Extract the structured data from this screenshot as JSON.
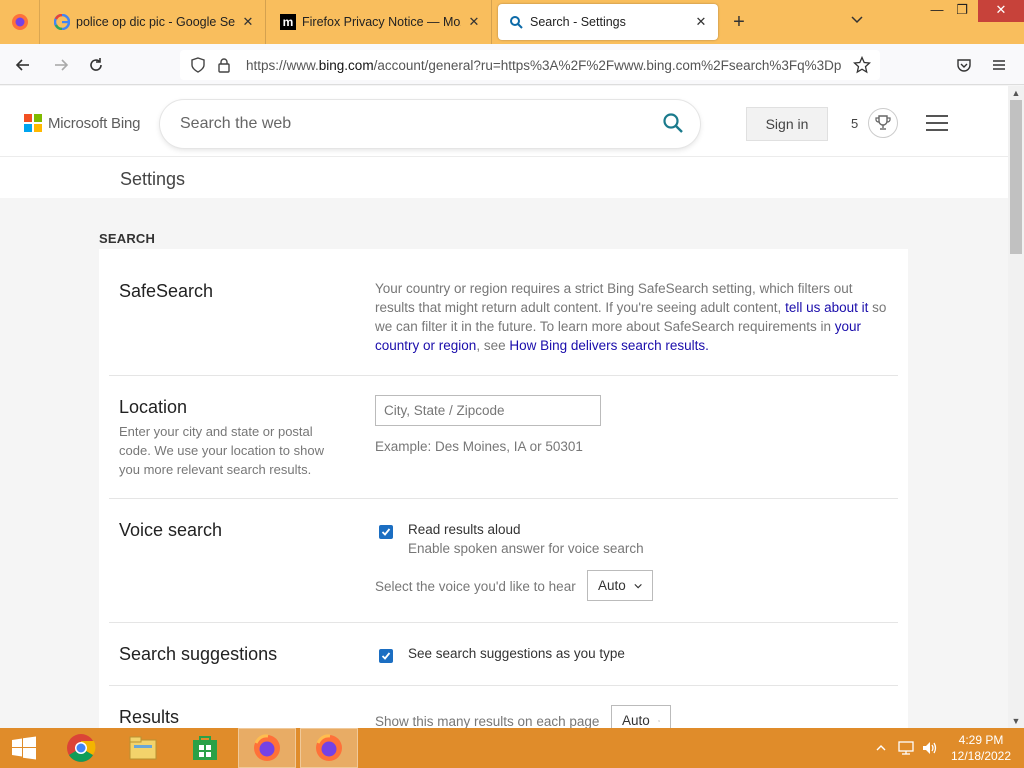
{
  "browser": {
    "tabs": [
      {
        "title": "police op dic pic - Google Searc",
        "close": "✕"
      },
      {
        "title": "Firefox Privacy Notice — Mozilla",
        "close": "✕"
      },
      {
        "title": "Search - Settings",
        "close": "✕"
      }
    ],
    "new_tab": "+",
    "window": {
      "minimize": "—",
      "restore": "❐",
      "close": "✕"
    },
    "url": {
      "prefix": "https://www.",
      "host": "bing.com",
      "path": "/account/general?ru=https%3A%2F%2Fwww.bing.com%2Fsearch%3Fq%3Dp"
    }
  },
  "bing": {
    "logo_text": "Microsoft Bing",
    "logo_colors": [
      "#f25022",
      "#7fba00",
      "#00a4ef",
      "#ffb900"
    ],
    "search_placeholder": "Search the web",
    "sign_in": "Sign in",
    "points": "5"
  },
  "page": {
    "title": "Settings",
    "section": "SEARCH",
    "safesearch": {
      "title": "SafeSearch",
      "text1": "Your country or region requires a strict Bing SafeSearch setting, which filters out results that might return adult content. If you're seeing adult content, ",
      "link1": "tell us about it",
      "text2": " so we can filter it in the future. To learn more about SafeSearch requirements in ",
      "link2": "your country or region",
      "text3": ", see ",
      "link3": "How Bing delivers search results."
    },
    "location": {
      "title": "Location",
      "desc": "Enter your city and state or postal code. We use your location to show you more relevant search results.",
      "placeholder": "City, State / Zipcode",
      "example": "Example: Des Moines, IA or 50301"
    },
    "voice": {
      "title": "Voice search",
      "checkbox_label": "Read results aloud",
      "checked": true,
      "sub": "Enable spoken answer for voice search",
      "select_label": "Select the voice you'd like to hear",
      "select_value": "Auto"
    },
    "suggestions": {
      "title": "Search suggestions",
      "checkbox_label": "See search suggestions as you type",
      "checked": true
    },
    "results": {
      "title": "Results",
      "label": "Show this many results on each page",
      "select_value": "Auto"
    }
  },
  "taskbar": {
    "time": "4:29 PM",
    "date": "12/18/2022"
  }
}
